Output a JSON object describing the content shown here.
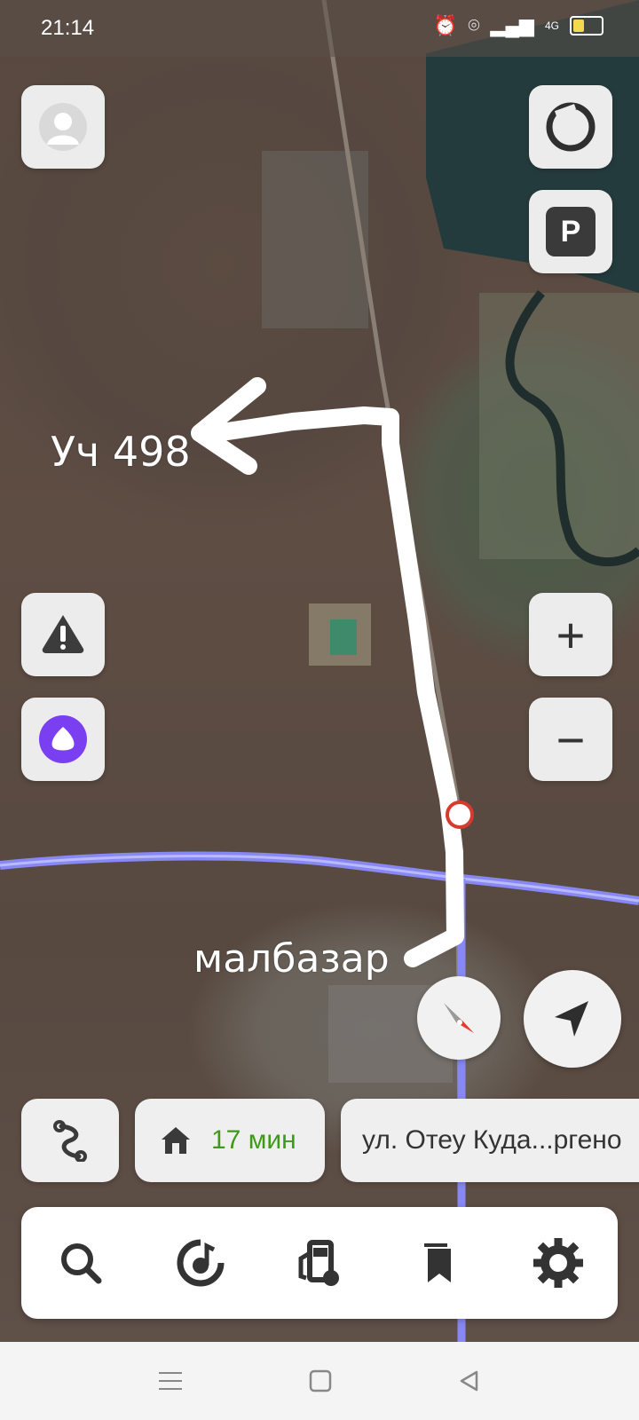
{
  "status_bar": {
    "time": "21:14",
    "network": "4G"
  },
  "map": {
    "annotation_destination": "Уч 498",
    "annotation_start": "малбазар"
  },
  "controls": {
    "parking_label": "P",
    "zoom_in": "+",
    "zoom_out": "−"
  },
  "route_bar": {
    "home_eta": "17 мин",
    "current_street": "ул. Отеу Куда...ргено"
  },
  "colors": {
    "eta_green": "#3e9a18",
    "alice_purple": "#7b3ff2",
    "compass_red": "#e63a2e",
    "road_blue": "#6f6ff0"
  },
  "toolbar_icons": [
    "search-icon",
    "music-icon",
    "fuel-icon",
    "bookmarks-icon",
    "gear-icon"
  ],
  "navbar_icons": [
    "menu-icon",
    "home-icon",
    "back-icon"
  ]
}
